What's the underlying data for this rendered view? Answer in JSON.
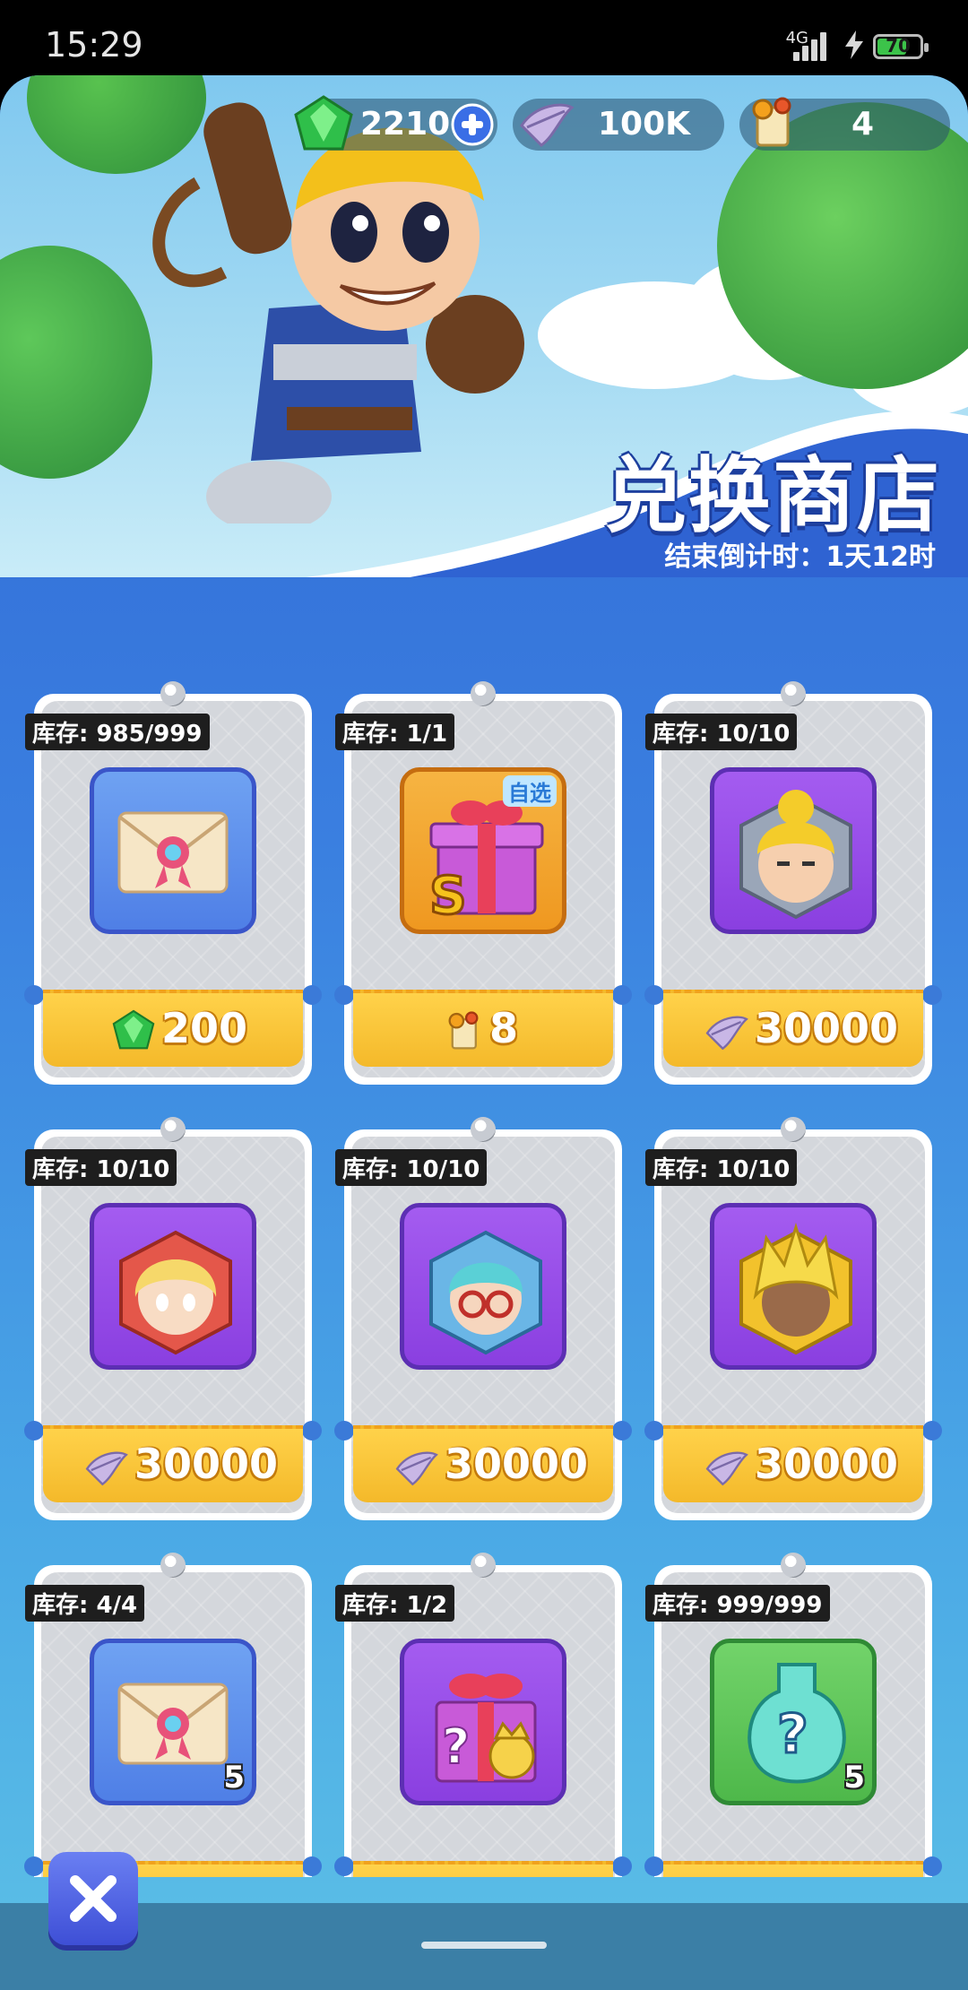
{
  "status_bar": {
    "time": "15:29",
    "network": "4G",
    "battery": "70"
  },
  "currencies": {
    "gems": "2210",
    "feathers": "100K",
    "tickets": "4"
  },
  "shop": {
    "title": "兑换商店",
    "countdown": "结束倒计时：1天12时"
  },
  "items": [
    {
      "stock": "库存: 985/999",
      "price": "200",
      "currency_icon": "gem-icon",
      "item_icon": "envelope-icon",
      "qty": ""
    },
    {
      "stock": "库存: 1/1",
      "price": "8",
      "currency_icon": "ticket-icon",
      "item_icon": "gift-box-icon",
      "tag": "自选",
      "qty": ""
    },
    {
      "stock": "库存: 10/10",
      "price": "30000",
      "currency_icon": "feather-icon",
      "item_icon": "hero-avatar-icon",
      "qty": ""
    },
    {
      "stock": "库存: 10/10",
      "price": "30000",
      "currency_icon": "feather-icon",
      "item_icon": "hero-avatar-icon",
      "qty": ""
    },
    {
      "stock": "库存: 10/10",
      "price": "30000",
      "currency_icon": "feather-icon",
      "item_icon": "hero-avatar-icon",
      "qty": ""
    },
    {
      "stock": "库存: 10/10",
      "price": "30000",
      "currency_icon": "feather-icon",
      "item_icon": "hero-avatar-icon",
      "qty": ""
    },
    {
      "stock": "库存: 4/4",
      "price": "",
      "currency_icon": "",
      "item_icon": "envelope-icon",
      "qty": "5"
    },
    {
      "stock": "库存: 1/2",
      "price": "",
      "currency_icon": "",
      "item_icon": "mystery-gift-icon",
      "qty": ""
    },
    {
      "stock": "库存: 999/999",
      "price": "",
      "currency_icon": "",
      "item_icon": "mystery-potion-icon",
      "qty": "5"
    }
  ],
  "colors": {
    "background": "#3a7fe0",
    "price_bar": "#f4b92a",
    "card": "#d4d7dc"
  }
}
